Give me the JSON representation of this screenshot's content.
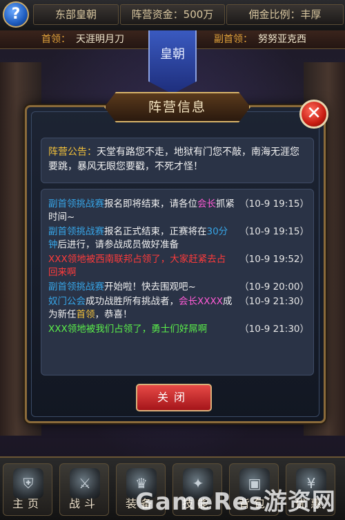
{
  "top_bar": {
    "help_label": "?",
    "faction_name": "东部皇朝",
    "funds": "阵营资金：500万",
    "commission": "佣金比例：丰厚"
  },
  "leaders": {
    "leader_label": "首领：",
    "leader_name": "天涯明月刀",
    "vice_label": "副首领：",
    "vice_name": "努努亚克西"
  },
  "banner_text": "皇朝",
  "dialog": {
    "title": "阵营信息",
    "notice_label": "阵营公告：",
    "notice_text": "天堂有路您不走，地狱有门您不敲，南海无涯您要跳，暴风无眼您要戳，不死才怪！",
    "close_button": "关闭",
    "log": [
      {
        "segments": [
          {
            "text": "副首领挑战赛",
            "color": "blue"
          },
          {
            "text": "报名即将结束，请各位",
            "color": "white"
          },
          {
            "text": "会长",
            "color": "pink"
          },
          {
            "text": "抓紧时间~",
            "color": "white"
          }
        ],
        "time": "（10-9 19:15）"
      },
      {
        "segments": [
          {
            "text": "副首领挑战赛",
            "color": "blue"
          },
          {
            "text": "报名正式结束，正赛将在",
            "color": "white"
          },
          {
            "text": "30分钟",
            "color": "blue"
          },
          {
            "text": "后进行，请参战成员做好准备",
            "color": "white"
          }
        ],
        "time": "（10-9 19:15）"
      },
      {
        "segments": [
          {
            "text": "XXX领地被西南联邦占领了，大家赶紧去占回来啊",
            "color": "red"
          }
        ],
        "time": "（10-9 19:52）"
      },
      {
        "segments": [
          {
            "text": "副首领挑战赛",
            "color": "blue"
          },
          {
            "text": "开始啦！快去围观吧~",
            "color": "white"
          }
        ],
        "time": "（10-9 20:00）"
      },
      {
        "segments": [
          {
            "text": "奴门公会",
            "color": "blue"
          },
          {
            "text": "成功战胜所有挑战者，",
            "color": "white"
          },
          {
            "text": "会长XXXX",
            "color": "pink"
          },
          {
            "text": "成为新任",
            "color": "white"
          },
          {
            "text": "首领",
            "color": "yellow"
          },
          {
            "text": "，恭喜！",
            "color": "white"
          }
        ],
        "time": "（10-9 21:30）"
      },
      {
        "segments": [
          {
            "text": "XXX领地被我们占领了，勇士们好屌啊",
            "color": "green"
          }
        ],
        "time": "（10-9 21:30）"
      }
    ]
  },
  "bottom_nav": [
    {
      "label": "主页",
      "icon": "home-icon"
    },
    {
      "label": "战斗",
      "icon": "swords-icon"
    },
    {
      "label": "装备",
      "icon": "equipment-icon"
    },
    {
      "label": "技能",
      "icon": "skill-icon"
    },
    {
      "label": "背包",
      "icon": "bag-icon"
    },
    {
      "label": "优惠",
      "icon": "discount-icon"
    }
  ],
  "watermark": "GameRes游资网",
  "colors": {
    "blue": "#37a6e8",
    "pink": "#ff5bd6",
    "yellow": "#f3c13a",
    "red": "#ff3b3b",
    "green": "#5bf04a",
    "white": "#f2f2f2",
    "button_red": "#c82a2a",
    "frame_gold": "#8a6a3a"
  }
}
